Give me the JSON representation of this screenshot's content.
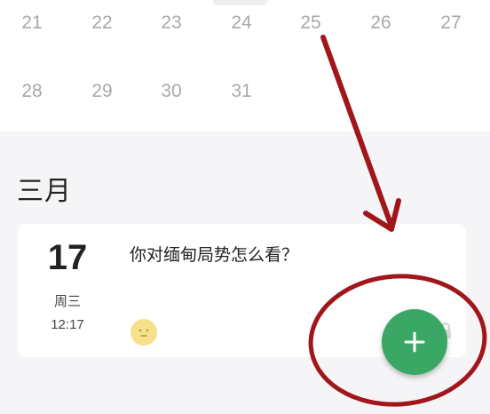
{
  "calendar": {
    "row1": [
      "21",
      "22",
      "23",
      "24",
      "25",
      "26",
      "27"
    ],
    "row2": [
      "28",
      "29",
      "30",
      "31"
    ]
  },
  "month_title": "三月",
  "entry": {
    "day": "17",
    "weekday": "周三",
    "time": "12:17",
    "text": "你对缅甸局势怎么看？",
    "mood_icon": "neutral-face-icon"
  },
  "fab": {
    "icon": "plus-icon",
    "color": "#3aa764"
  },
  "annotation": {
    "color": "#a0161b"
  }
}
